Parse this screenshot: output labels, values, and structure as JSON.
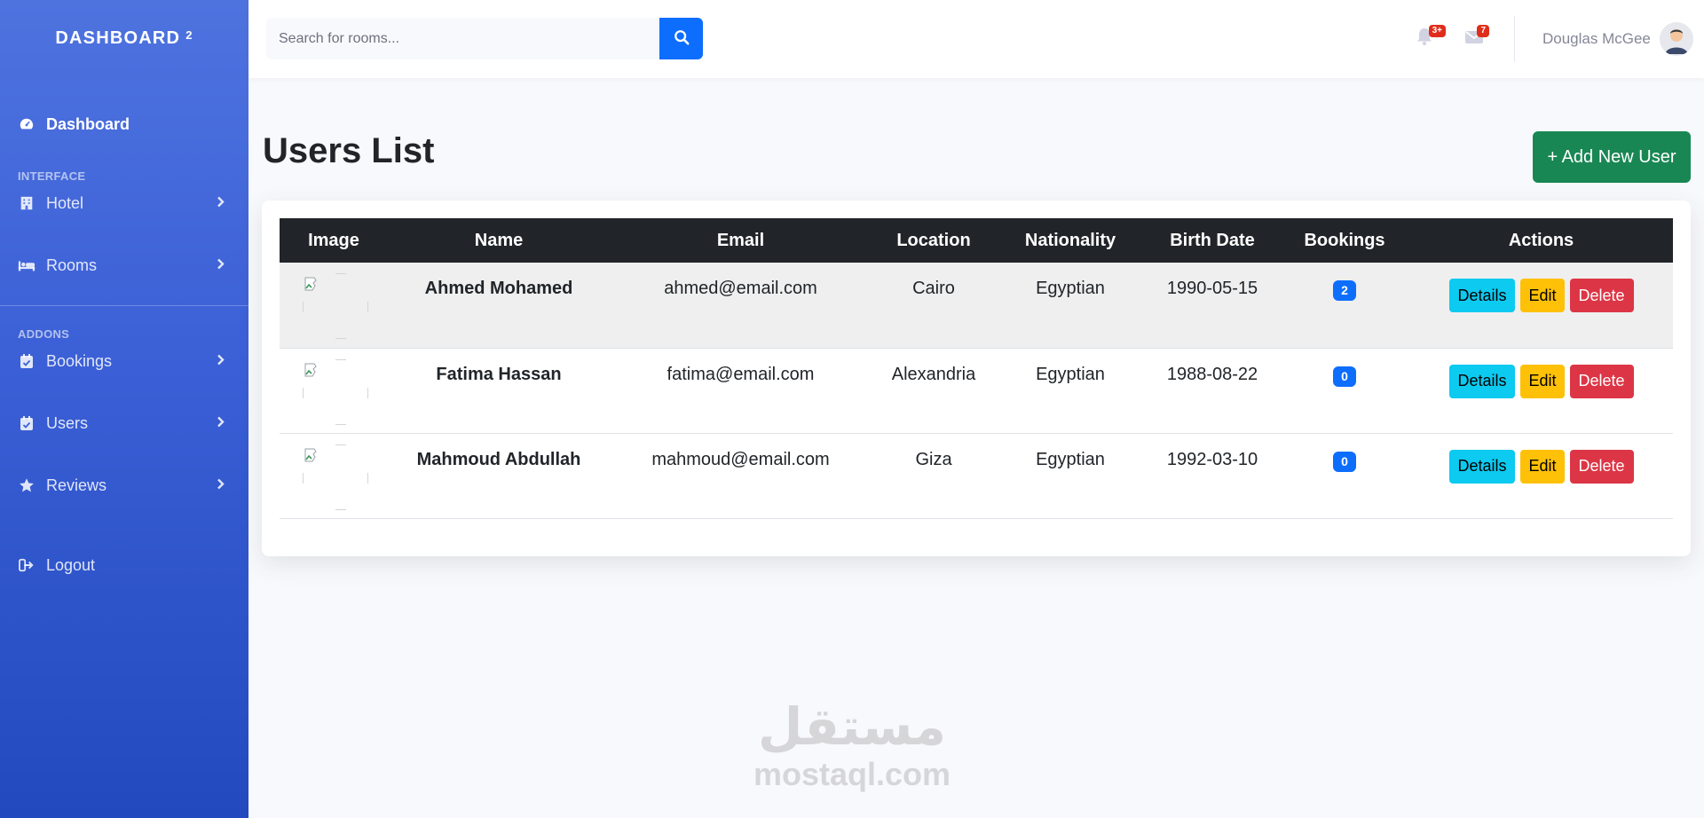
{
  "sidebar": {
    "brand": "DASHBOARD",
    "brand_sup": "2",
    "dashboard_label": "Dashboard",
    "interface_heading": "INTERFACE",
    "addons_heading": "ADDONS",
    "items": [
      {
        "label": "Hotel",
        "icon": "building-icon"
      },
      {
        "label": "Rooms",
        "icon": "bed-icon"
      },
      {
        "label": "Bookings",
        "icon": "calendar-check-icon"
      },
      {
        "label": "Users",
        "icon": "calendar-check-icon"
      },
      {
        "label": "Reviews",
        "icon": "star-icon"
      }
    ],
    "logout_label": "Logout"
  },
  "topbar": {
    "search_placeholder": "Search for rooms...",
    "alerts_badge": "3+",
    "messages_badge": "7",
    "user_name": "Douglas McGee"
  },
  "main": {
    "title": "Users List",
    "add_button": "+ Add New User",
    "columns": [
      "Image",
      "Name",
      "Email",
      "Location",
      "Nationality",
      "Birth Date",
      "Bookings",
      "Actions"
    ],
    "rows": [
      {
        "name": "Ahmed Mohamed",
        "email": "ahmed@email.com",
        "location": "Cairo",
        "nationality": "Egyptian",
        "birth_date": "1990-05-15",
        "bookings": "2"
      },
      {
        "name": "Fatima Hassan",
        "email": "fatima@email.com",
        "location": "Alexandria",
        "nationality": "Egyptian",
        "birth_date": "1988-08-22",
        "bookings": "0"
      },
      {
        "name": "Mahmoud Abdullah",
        "email": "mahmoud@email.com",
        "location": "Giza",
        "nationality": "Egyptian",
        "birth_date": "1992-03-10",
        "bookings": "0"
      }
    ],
    "actions": {
      "details": "Details",
      "edit": "Edit",
      "delete": "Delete"
    }
  },
  "watermark": {
    "arabic": "مستقل",
    "latin": "mostaql.com"
  },
  "colors": {
    "sidebar_top": "#4e73df",
    "sidebar_bottom": "#224abe",
    "primary": "#0d6efd",
    "success": "#198754",
    "info": "#0dcaf0",
    "warning": "#ffc107",
    "danger": "#dc3545",
    "table_head": "#212529"
  }
}
